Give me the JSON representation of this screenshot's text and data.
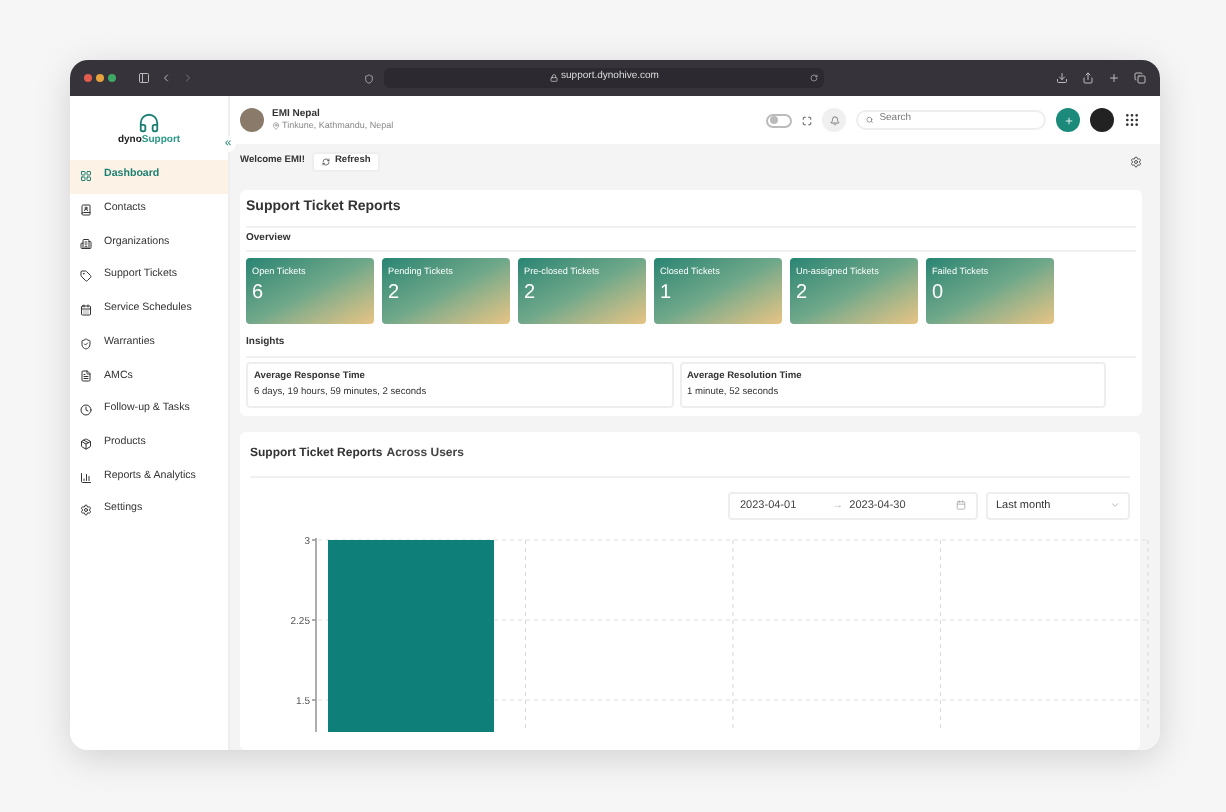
{
  "browser": {
    "address": "support.dynohive.com"
  },
  "user": {
    "name": "EMI Nepal",
    "location": "Tinkune, Kathmandu, Nepal"
  },
  "header": {
    "theme_toggle": {
      "on": false
    },
    "search": {
      "placeholder": "Search"
    }
  },
  "sidebar": {
    "logo": {
      "part_1": "dyno",
      "part_2": "Support"
    },
    "collapse_icon": "«",
    "items": [
      {
        "label": "Dashboard",
        "selected": true
      },
      {
        "label": "Contacts",
        "selected": false
      },
      {
        "label": "Organizations",
        "selected": false
      },
      {
        "label": "Support Tickets",
        "selected": false
      },
      {
        "label": "Service Schedules",
        "selected": false
      },
      {
        "label": "Warranties",
        "selected": false
      },
      {
        "label": "AMCs",
        "selected": false
      },
      {
        "label": "Follow-up & Tasks",
        "selected": false
      },
      {
        "label": "Products",
        "selected": false
      },
      {
        "label": "Reports & Analytics",
        "selected": false
      },
      {
        "label": "Settings",
        "selected": false
      }
    ]
  },
  "welcome": "Welcome EMI!",
  "refresh_button": "Refresh",
  "reports": {
    "title": "Support Ticket Reports",
    "overview_label": "Overview",
    "cards": [
      {
        "label": "Open Tickets",
        "count": "6"
      },
      {
        "label": "Pending Tickets",
        "count": "2"
      },
      {
        "label": "Pre-closed Tickets",
        "count": "2"
      },
      {
        "label": "Closed Tickets",
        "count": "1"
      },
      {
        "label": "Un-assigned Tickets",
        "count": "2"
      },
      {
        "label": "Failed Tickets",
        "count": "0"
      }
    ],
    "insights_label": "Insights",
    "insights": [
      {
        "label": "Average Response Time",
        "value": "6 days, 19 hours, 59 minutes, 2 seconds"
      },
      {
        "label": "Average Resolution Time",
        "value": "1 minute, 52 seconds"
      }
    ]
  },
  "users_report": {
    "title": "Support Ticket Reports",
    "title_suffix": "Across Users",
    "date_from": "2023-04-01",
    "range_separator": "→",
    "date_to": "2023-04-30",
    "period": "Last month",
    "chart_data": {
      "type": "bar",
      "categories": [
        null,
        null,
        null,
        null
      ],
      "series": [
        {
          "color": "#0f7f79",
          "values": [
            3,
            null,
            null,
            null
          ]
        }
      ],
      "ylim": [
        1.2,
        3
      ],
      "yticks": [
        {
          "value": 1.5,
          "label": "1.5"
        },
        {
          "value": 2.25,
          "label": "2.25"
        },
        {
          "value": 3,
          "label": "3"
        }
      ]
    }
  }
}
